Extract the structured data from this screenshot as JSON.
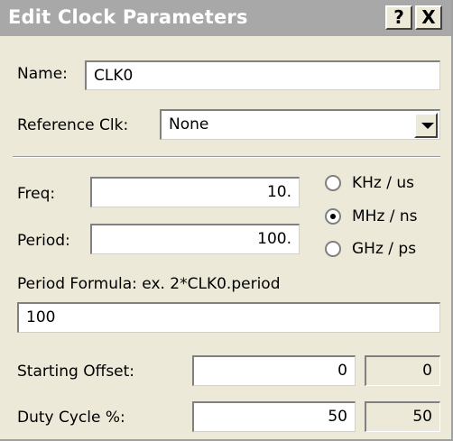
{
  "window": {
    "title": "Edit Clock Parameters",
    "help_label": "?",
    "close_label": "X"
  },
  "name": {
    "label": "Name:",
    "value": "CLK0"
  },
  "reference": {
    "label": "Reference Clk:",
    "value": "None"
  },
  "freq": {
    "label": "Freq:",
    "value": "10."
  },
  "period": {
    "label": "Period:",
    "value": "100."
  },
  "units": [
    {
      "label": "KHz / us",
      "selected": false
    },
    {
      "label": "MHz / ns",
      "selected": true
    },
    {
      "label": "GHz / ps",
      "selected": false
    }
  ],
  "formula": {
    "label": "Period Formula: ex. 2*CLK0.period",
    "value": "100"
  },
  "offset": {
    "label": "Starting Offset:",
    "value": "0",
    "computed": "0"
  },
  "duty": {
    "label": "Duty Cycle %:",
    "value": "50",
    "computed": "50"
  }
}
